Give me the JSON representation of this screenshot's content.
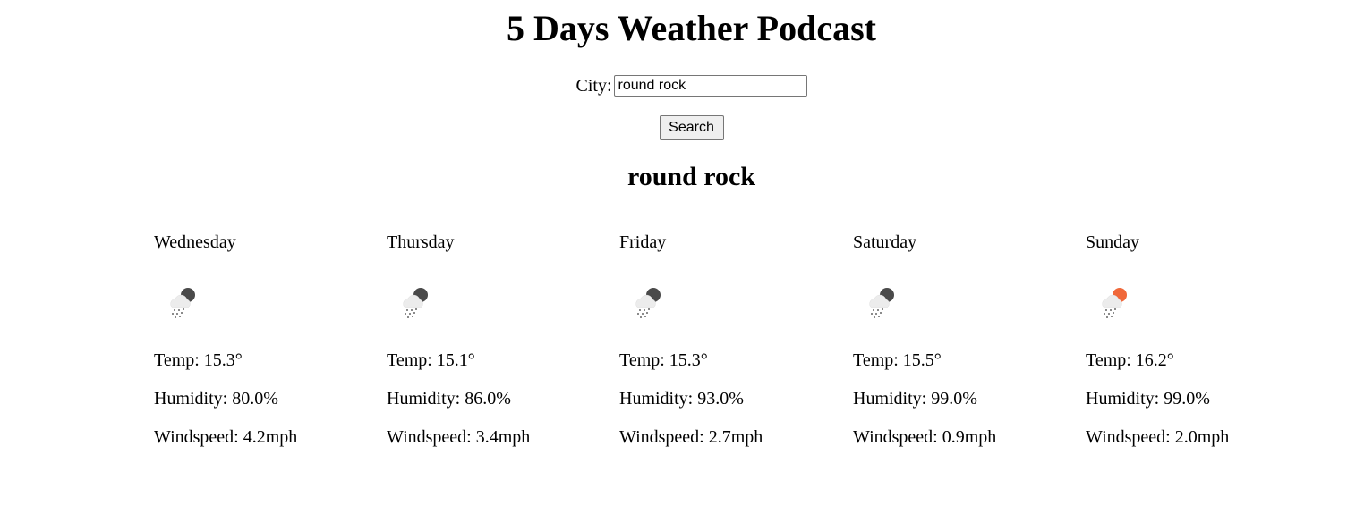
{
  "header": {
    "title": "5 Days Weather Podcast"
  },
  "search": {
    "label": "City:",
    "value": "round rock",
    "button_label": "Search"
  },
  "city_name": "round rock",
  "forecast": [
    {
      "day": "Wednesday",
      "icon": "light-rain-night-icon",
      "icon_color": "#4a4a4a",
      "temp": "Temp: 15.3°",
      "humidity": "Humidity: 80.0%",
      "windspeed": "Windspeed: 4.2mph"
    },
    {
      "day": "Thursday",
      "icon": "light-rain-night-icon",
      "icon_color": "#4a4a4a",
      "temp": "Temp: 15.1°",
      "humidity": "Humidity: 86.0%",
      "windspeed": "Windspeed: 3.4mph"
    },
    {
      "day": "Friday",
      "icon": "light-rain-night-icon",
      "icon_color": "#4a4a4a",
      "temp": "Temp: 15.3°",
      "humidity": "Humidity: 93.0%",
      "windspeed": "Windspeed: 2.7mph"
    },
    {
      "day": "Saturday",
      "icon": "light-rain-night-icon",
      "icon_color": "#4a4a4a",
      "temp": "Temp: 15.5°",
      "humidity": "Humidity: 99.0%",
      "windspeed": "Windspeed: 0.9mph"
    },
    {
      "day": "Sunday",
      "icon": "light-rain-day-icon",
      "icon_color": "#f0683a",
      "temp": "Temp: 16.2°",
      "humidity": "Humidity: 99.0%",
      "windspeed": "Windspeed: 2.0mph"
    }
  ]
}
